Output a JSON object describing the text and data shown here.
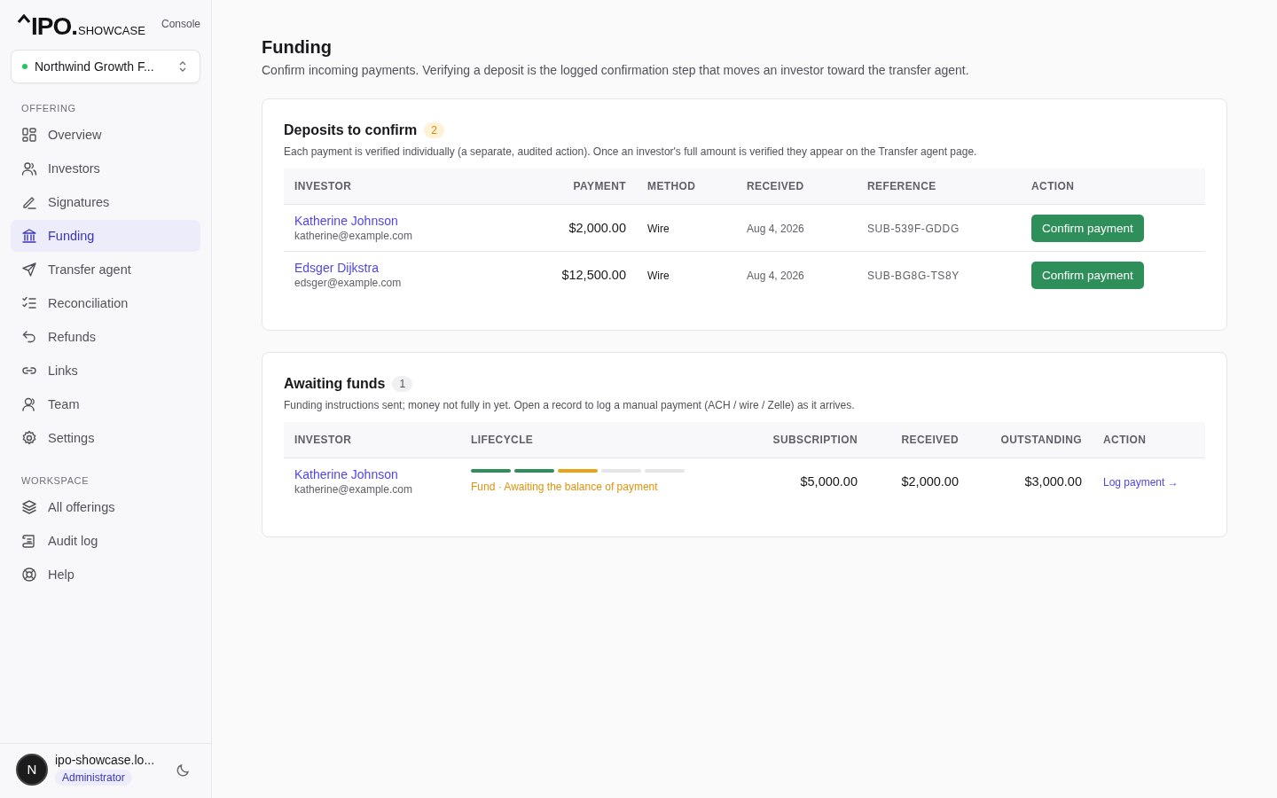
{
  "brand": {
    "logo": "IPO.",
    "logo_suffix": "SHOWCASE",
    "console": "Console"
  },
  "offering_selector": {
    "value": "Northwind Growth F...",
    "color": "#22c55e"
  },
  "sidebar": {
    "sections": [
      {
        "title": "OFFERING",
        "items": [
          {
            "label": "Overview",
            "selected": false
          },
          {
            "label": "Investors",
            "selected": false
          },
          {
            "label": "Signatures",
            "selected": false
          },
          {
            "label": "Funding",
            "selected": true
          },
          {
            "label": "Transfer agent",
            "selected": false
          },
          {
            "label": "Reconciliation",
            "selected": false
          },
          {
            "label": "Refunds",
            "selected": false
          },
          {
            "label": "Links",
            "selected": false
          },
          {
            "label": "Team",
            "selected": false
          },
          {
            "label": "Settings",
            "selected": false
          }
        ]
      },
      {
        "title": "WORKSPACE",
        "items": [
          {
            "label": "All offerings",
            "selected": false
          },
          {
            "label": "Audit log",
            "selected": false
          },
          {
            "label": "Help",
            "selected": false
          }
        ]
      }
    ]
  },
  "user": {
    "email": "ipo-showcase.lo...",
    "role": "Administrator",
    "avatar": "N"
  },
  "page": {
    "title": "Funding",
    "subtitle": "Confirm incoming payments. Verifying a deposit is the logged confirmation step that moves an investor toward the transfer agent."
  },
  "deposits": {
    "title": "Deposits to confirm",
    "count": "2",
    "description": "Each payment is verified individually (a separate, audited action). Once an investor's full amount is verified they appear on the Transfer agent page.",
    "columns": [
      "INVESTOR",
      "PAYMENT",
      "METHOD",
      "RECEIVED",
      "REFERENCE",
      "ACTION"
    ],
    "rows": [
      {
        "name": "Katherine Johnson",
        "email": "katherine@example.com",
        "payment": "$2,000.00",
        "method": "Wire",
        "received": "Aug 4, 2026",
        "reference": "SUB-539F-GDDG",
        "action": "Confirm payment"
      },
      {
        "name": "Edsger Dijkstra",
        "email": "edsger@example.com",
        "payment": "$12,500.00",
        "method": "Wire",
        "received": "Aug 4, 2026",
        "reference": "SUB-BG8G-TS8Y",
        "action": "Confirm payment"
      }
    ]
  },
  "awaiting": {
    "title": "Awaiting funds",
    "count": "1",
    "description": "Funding instructions sent; money not fully in yet. Open a record to log a manual payment (ACH / wire / Zelle) as it arrives.",
    "columns": [
      "INVESTOR",
      "LIFECYCLE",
      "SUBSCRIPTION",
      "RECEIVED",
      "OUTSTANDING",
      "ACTION"
    ],
    "rows": [
      {
        "name": "Katherine Johnson",
        "email": "katherine@example.com",
        "steps": [
          {
            "kind": "done"
          },
          {
            "kind": "done"
          },
          {
            "kind": "current"
          },
          {
            "kind": "pending"
          },
          {
            "kind": "pending"
          }
        ],
        "status": "Fund · Awaiting the balance of payment",
        "subscription": "$5,000.00",
        "received": "$2,000.00",
        "outstanding": "$3,000.00",
        "action": "Log payment →"
      }
    ]
  }
}
